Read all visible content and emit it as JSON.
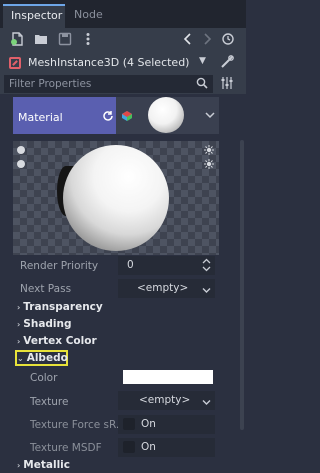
{
  "tabs": {
    "inspector": "Inspector",
    "node": "Node"
  },
  "object": {
    "label": "MeshInstance3D (4 Selected)"
  },
  "filter": {
    "placeholder": "Filter Properties"
  },
  "material": {
    "label": "Material"
  },
  "props": {
    "render_priority": {
      "label": "Render Priority",
      "value": "0"
    },
    "next_pass": {
      "label": "Next Pass",
      "value": "<empty>"
    },
    "transparency": "Transparency",
    "shading": "Shading",
    "vertex_color": "Vertex Color",
    "albedo": "Albedo",
    "color": {
      "label": "Color",
      "value": "#ffffff"
    },
    "texture": {
      "label": "Texture",
      "value": "<empty>"
    },
    "texture_force_srgb": {
      "label": "Texture Force sR...",
      "value": "On"
    },
    "texture_msdf": {
      "label": "Texture MSDF",
      "value": "On"
    },
    "metallic": "Metallic"
  },
  "colors": {
    "accent": "#6ea6e8",
    "material_header": "#5a5fb0",
    "highlight": "#e8e23a"
  }
}
